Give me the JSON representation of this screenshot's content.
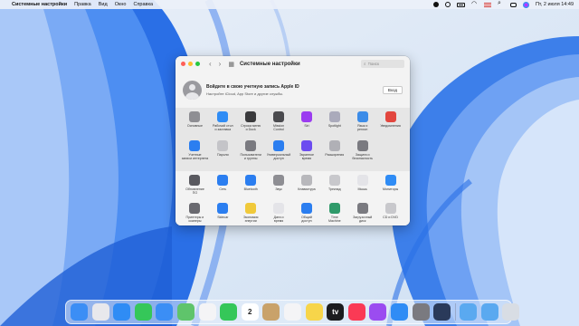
{
  "menubar": {
    "app_name": "Системные настройки",
    "items": [
      "Правка",
      "Вид",
      "Окно",
      "Справка"
    ],
    "datetime": "Пт, 2 июля 14:49"
  },
  "window": {
    "title": "Системные настройки",
    "search_placeholder": "Поиск",
    "account": {
      "title": "Войдите в свою учетную запись Apple ID",
      "subtitle": "Настройте iCloud, App Store и другие службы.",
      "login_label": "Вход"
    },
    "section1": [
      {
        "label": "Основные",
        "icon": "general-icon",
        "color": "#8e8e93"
      },
      {
        "label": "Рабочий стол\nи заставка",
        "icon": "desktop-icon",
        "color": "#2f8cf5"
      },
      {
        "label": "Строка меню\nи Dock",
        "icon": "dock-icon",
        "color": "#3a3a3c"
      },
      {
        "label": "Mission\nControl",
        "icon": "mission-control-icon",
        "color": "#4a4a4e"
      },
      {
        "label": "Siri",
        "icon": "siri-icon",
        "color": "#9b3cf0"
      },
      {
        "label": "Spotlight",
        "icon": "spotlight-icon",
        "color": "#aab"
      },
      {
        "label": "Язык и\nрегион",
        "icon": "language-icon",
        "color": "#3c8ce8"
      },
      {
        "label": "Уведомления",
        "icon": "notifications-icon",
        "color": "#e2463e"
      },
      {
        "label": "Учетные\nзаписи интернета",
        "icon": "internet-accounts-icon",
        "color": "#2b7ef0"
      },
      {
        "label": "Пароли",
        "icon": "passwords-icon",
        "color": "#c4c4c8"
      },
      {
        "label": "Пользователи\nи группы",
        "icon": "users-icon",
        "color": "#7a7a80"
      },
      {
        "label": "Универсальный\nдоступ",
        "icon": "accessibility-icon",
        "color": "#2b7ef0"
      },
      {
        "label": "Экранное\nвремя",
        "icon": "screen-time-icon",
        "color": "#6c4cf0"
      },
      {
        "label": "Расширения",
        "icon": "extensions-icon",
        "color": "#b0b0b6"
      },
      {
        "label": "Защита и\nбезопасность",
        "icon": "security-icon",
        "color": "#7a7a80"
      }
    ],
    "section2": [
      {
        "label": "Обновление\nПО",
        "icon": "software-update-icon",
        "color": "#5a5a60"
      },
      {
        "label": "Сеть",
        "icon": "network-icon",
        "color": "#2b7ef0"
      },
      {
        "label": "Bluetooth",
        "icon": "bluetooth-icon",
        "color": "#2b7ef0"
      },
      {
        "label": "Звук",
        "icon": "sound-icon",
        "color": "#8e8e93"
      },
      {
        "label": "Клавиатура",
        "icon": "keyboard-icon",
        "color": "#b8b8bc"
      },
      {
        "label": "Трекпад",
        "icon": "trackpad-icon",
        "color": "#c8c8cc"
      },
      {
        "label": "Мышь",
        "icon": "mouse-icon",
        "color": "#e4e4e8"
      },
      {
        "label": "Мониторы",
        "icon": "displays-icon",
        "color": "#2f8cf5"
      },
      {
        "label": "Принтеры и\nсканеры",
        "icon": "printers-icon",
        "color": "#6a6a70"
      },
      {
        "label": "Sidecar",
        "icon": "sidecar-icon",
        "color": "#2b7ef0"
      },
      {
        "label": "Экономия\nэнергии",
        "icon": "energy-icon",
        "color": "#f0c93a"
      },
      {
        "label": "Дата и\nвремя",
        "icon": "date-time-icon",
        "color": "#e4e4e8"
      },
      {
        "label": "Общий\nдоступ",
        "icon": "sharing-icon",
        "color": "#2b7ef0"
      },
      {
        "label": "Time\nMachine",
        "icon": "time-machine-icon",
        "color": "#2f9a6a"
      },
      {
        "label": "Загрузочный\nдиск",
        "icon": "startup-disk-icon",
        "color": "#7a7a80"
      },
      {
        "label": "CD и DVD",
        "icon": "cd-dvd-icon",
        "color": "#c8c8cc"
      }
    ]
  },
  "dock": [
    {
      "name": "finder-icon",
      "color": "#3b8ef5"
    },
    {
      "name": "launchpad-icon",
      "color": "#e8e8ec"
    },
    {
      "name": "safari-icon",
      "color": "#2f8cf5"
    },
    {
      "name": "messages-icon",
      "color": "#35c759"
    },
    {
      "name": "mail-icon",
      "color": "#3b8ef5"
    },
    {
      "name": "maps-icon",
      "color": "#5fc46b"
    },
    {
      "name": "photos-icon",
      "color": "#f4f4f6"
    },
    {
      "name": "facetime-icon",
      "color": "#35c759"
    },
    {
      "name": "calendar-icon",
      "color": "#ffffff",
      "text": "2"
    },
    {
      "name": "contacts-icon",
      "color": "#c9a26a"
    },
    {
      "name": "reminders-icon",
      "color": "#f4f4f6"
    },
    {
      "name": "notes-icon",
      "color": "#f7d54a"
    },
    {
      "name": "tv-icon",
      "color": "#1c1c1e",
      "text": "tv"
    },
    {
      "name": "music-icon",
      "color": "#fa3a55"
    },
    {
      "name": "podcasts-icon",
      "color": "#9b4cf0"
    },
    {
      "name": "app-store-icon",
      "color": "#2f8cf5"
    },
    {
      "name": "system-preferences-icon",
      "color": "#7a7a80"
    },
    {
      "name": "quicktime-icon",
      "color": "#2a3a5a"
    },
    {
      "name": "downloads-folder-icon",
      "color": "#5aa9f0"
    },
    {
      "name": "documents-folder-icon",
      "color": "#5aa9f0"
    },
    {
      "name": "trash-icon",
      "color": "#d8dde4"
    }
  ]
}
